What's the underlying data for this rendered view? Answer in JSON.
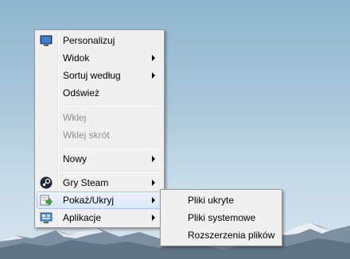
{
  "context_menu": {
    "items": [
      {
        "label": "Personalizuj",
        "icon": "monitor-icon"
      },
      {
        "label": "Widok",
        "submenu": true
      },
      {
        "label": "Sortuj według",
        "submenu": true
      },
      {
        "label": "Odśwież"
      },
      {
        "label": "Wklej",
        "disabled": true
      },
      {
        "label": "Wklej skrót",
        "disabled": true
      },
      {
        "label": "Nowy",
        "submenu": true
      },
      {
        "label": "Gry Steam",
        "icon": "steam-icon",
        "submenu": true
      },
      {
        "label": "Pokaż/Ukryj",
        "icon": "show-hide-icon",
        "submenu": true,
        "active": true
      },
      {
        "label": "Aplikacje",
        "icon": "apps-icon",
        "submenu": true
      }
    ]
  },
  "submenu": {
    "items": [
      {
        "label": "Pliki ukryte"
      },
      {
        "label": "Pliki systemowe"
      },
      {
        "label": "Rozszerzenia plików"
      }
    ]
  },
  "colors": {
    "menu_bg": "#f0f0f0",
    "highlight": "#d8e7fb",
    "highlight_border": "#a8c4ec",
    "disabled_text": "#8d8d8d"
  }
}
